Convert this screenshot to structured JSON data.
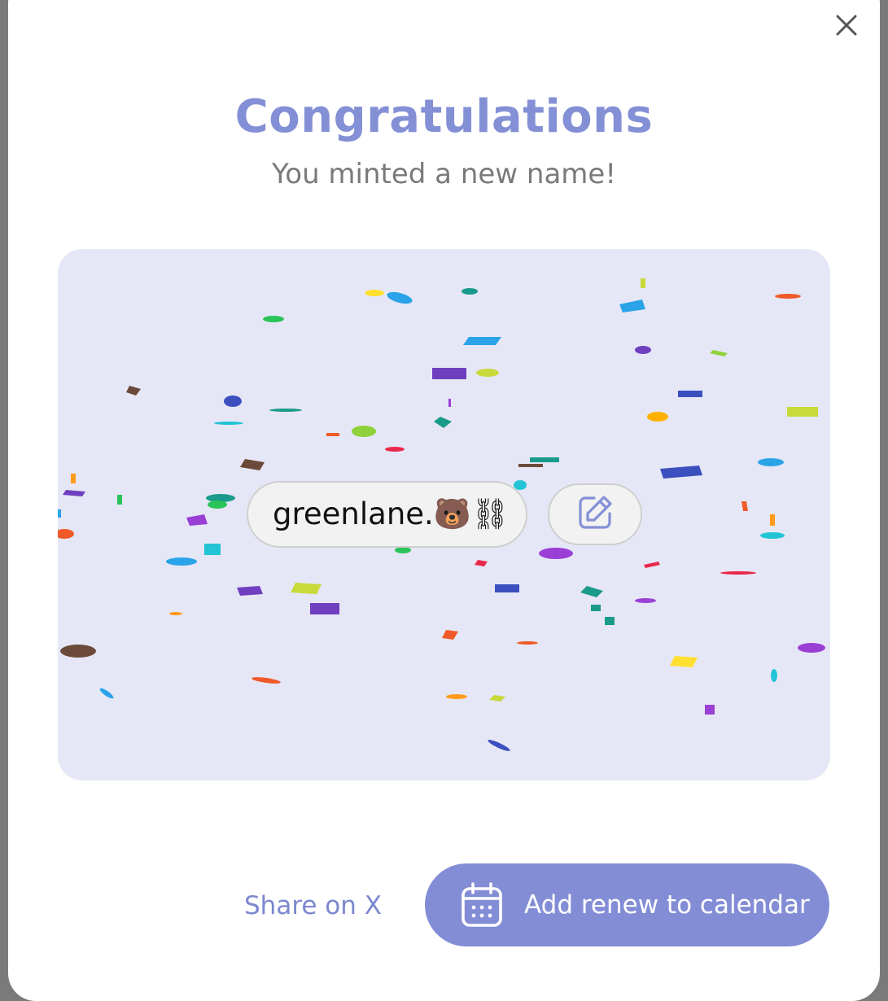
{
  "modal": {
    "title": "Congratulations",
    "subtitle": "You minted a new name!",
    "close_icon": "close-icon"
  },
  "name_card": {
    "name": "greenlane.🐻⛓",
    "edit_icon": "edit-icon"
  },
  "actions": {
    "share_label": "Share on X",
    "calendar_label": "Add renew to calendar",
    "calendar_icon": "calendar-icon"
  },
  "colors": {
    "accent": "#838dd6",
    "title": "#8490d6",
    "stage_bg": "#e6e7f6"
  }
}
